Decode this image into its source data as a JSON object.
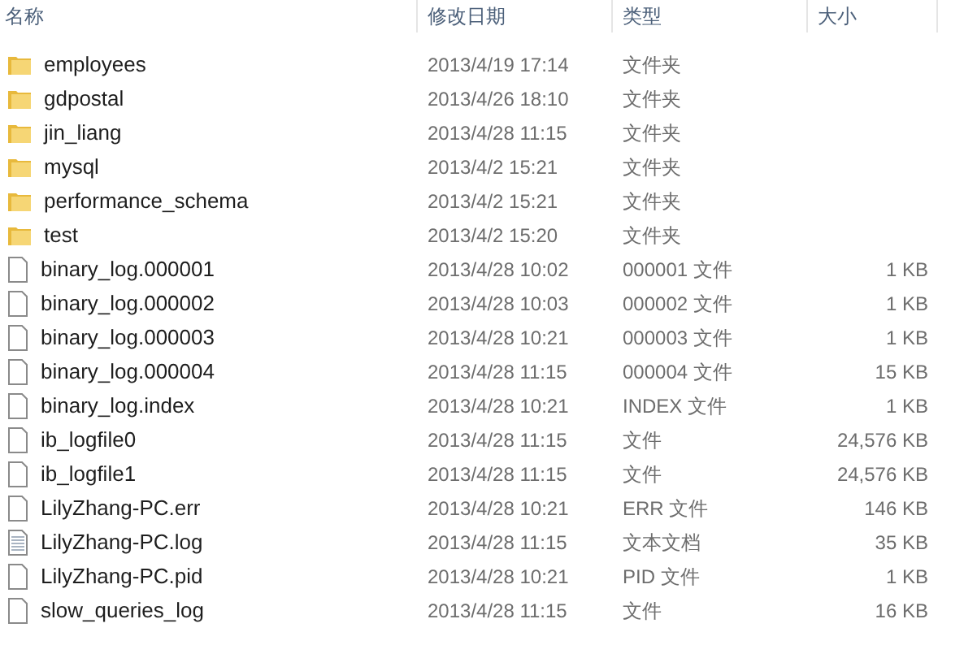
{
  "columns": [
    "名称",
    "修改日期",
    "类型",
    "大小"
  ],
  "rows": [
    {
      "kind": "folder",
      "name": "employees",
      "date": "2013/4/19 17:14",
      "type": "文件夹"
    },
    {
      "kind": "folder",
      "name": "gdpostal",
      "date": "2013/4/26 18:10",
      "type": "文件夹"
    },
    {
      "kind": "folder",
      "name": "jin_liang",
      "date": "2013/4/28 11:15",
      "type": "文件夹"
    },
    {
      "kind": "folder",
      "name": "mysql",
      "date": "2013/4/2 15:21",
      "type": "文件夹"
    },
    {
      "kind": "folder",
      "name": "performance_schema",
      "date": "2013/4/2 15:21",
      "type": "文件夹"
    },
    {
      "kind": "folder",
      "name": "test",
      "date": "2013/4/2 15:20",
      "type": "文件夹"
    },
    {
      "kind": "file",
      "name": "binary_log.000001",
      "date": "2013/4/28 10:02",
      "type": "000001 文件",
      "size": "1 KB"
    },
    {
      "kind": "file",
      "name": "binary_log.000002",
      "date": "2013/4/28 10:03",
      "type": "000002 文件",
      "size": "1 KB"
    },
    {
      "kind": "file",
      "name": "binary_log.000003",
      "date": "2013/4/28 10:21",
      "type": "000003 文件",
      "size": "1 KB"
    },
    {
      "kind": "file",
      "name": "binary_log.000004",
      "date": "2013/4/28 11:15",
      "type": "000004 文件",
      "size": "15 KB"
    },
    {
      "kind": "file",
      "name": "binary_log.index",
      "date": "2013/4/28 10:21",
      "type": "INDEX 文件",
      "size": "1 KB"
    },
    {
      "kind": "file",
      "name": "ib_logfile0",
      "date": "2013/4/28 11:15",
      "type": "文件",
      "size": "24,576 KB"
    },
    {
      "kind": "file",
      "name": "ib_logfile1",
      "date": "2013/4/28 11:15",
      "type": "文件",
      "size": "24,576 KB"
    },
    {
      "kind": "file",
      "name": "LilyZhang-PC.err",
      "date": "2013/4/28 10:21",
      "type": "ERR 文件",
      "size": "146 KB"
    },
    {
      "kind": "text",
      "name": "LilyZhang-PC.log",
      "date": "2013/4/28 11:15",
      "type": "文本文档",
      "size": "35 KB"
    },
    {
      "kind": "file",
      "name": "LilyZhang-PC.pid",
      "date": "2013/4/28 10:21",
      "type": "PID 文件",
      "size": "1 KB"
    },
    {
      "kind": "file",
      "name": "slow_queries_log",
      "date": "2013/4/28 11:15",
      "type": "文件",
      "size": "16 KB"
    }
  ]
}
